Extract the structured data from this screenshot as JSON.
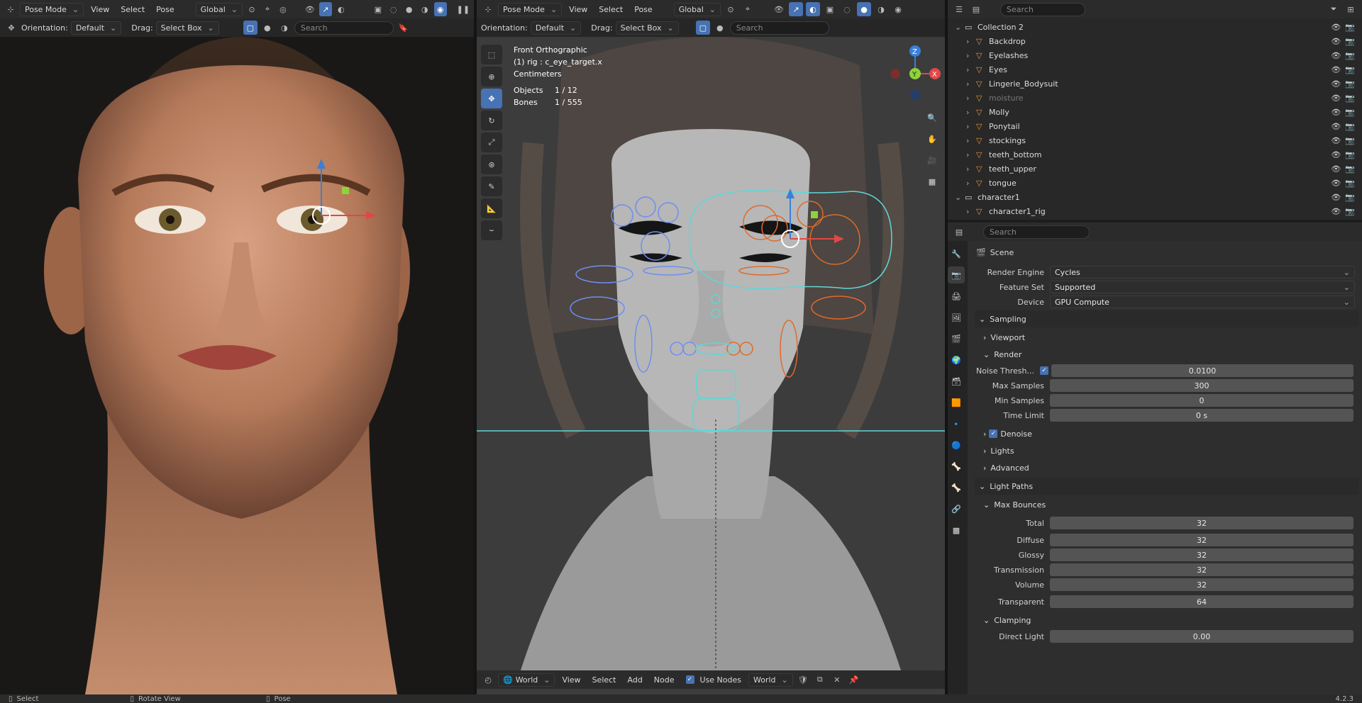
{
  "left_view": {
    "mode": "Pose Mode",
    "menus": [
      "View",
      "Select",
      "Pose"
    ],
    "transform_space": "Global",
    "orientation_label": "Orientation:",
    "orientation_value": "Default",
    "drag_label": "Drag:",
    "drag_value": "Select Box",
    "search_placeholder": "Search"
  },
  "right_view": {
    "mode": "Pose Mode",
    "menus": [
      "View",
      "Select",
      "Pose"
    ],
    "transform_space": "Global",
    "orientation_label": "Orientation:",
    "orientation_value": "Default",
    "drag_label": "Drag:",
    "drag_value": "Select Box",
    "search_placeholder": "Search",
    "overlay": {
      "view_name": "Front Orthographic",
      "selection": "(1) rig : c_eye_target.x",
      "units": "Centimeters",
      "objects_label": "Objects",
      "objects_value": "1 / 12",
      "bones_label": "Bones",
      "bones_value": "1 / 555"
    },
    "bottom_bar": {
      "world_dropdown": "World",
      "menus": [
        "View",
        "Select",
        "Add",
        "Node"
      ],
      "use_nodes": "Use Nodes",
      "world_name": "World"
    }
  },
  "outliner": {
    "search_placeholder": "Search",
    "rows": [
      {
        "label": "Collection 2",
        "indent": 0
      },
      {
        "label": "Backdrop",
        "indent": 1
      },
      {
        "label": "Eyelashes",
        "indent": 1
      },
      {
        "label": "Eyes",
        "indent": 1
      },
      {
        "label": "Lingerie_Bodysuit",
        "indent": 1
      },
      {
        "label": "moisture",
        "indent": 1
      },
      {
        "label": "Molly",
        "indent": 1
      },
      {
        "label": "Ponytail",
        "indent": 1
      },
      {
        "label": "stockings",
        "indent": 1
      },
      {
        "label": "teeth_bottom",
        "indent": 1
      },
      {
        "label": "teeth_upper",
        "indent": 1
      },
      {
        "label": "tongue",
        "indent": 1
      },
      {
        "label": "character1",
        "indent": 0
      },
      {
        "label": "character1_rig",
        "indent": 1
      }
    ]
  },
  "properties": {
    "search_placeholder": "Search",
    "scene_label": "Scene",
    "render_engine_label": "Render Engine",
    "render_engine_value": "Cycles",
    "feature_set_label": "Feature Set",
    "feature_set_value": "Supported",
    "device_label": "Device",
    "device_value": "GPU Compute",
    "sampling": "Sampling",
    "viewport": "Viewport",
    "render": "Render",
    "noise_label": "Noise Thresh...",
    "noise_value": "0.0100",
    "max_samples_label": "Max Samples",
    "max_samples_value": "300",
    "min_samples_label": "Min Samples",
    "min_samples_value": "0",
    "time_limit_label": "Time Limit",
    "time_limit_value": "0 s",
    "denoise": "Denoise",
    "lights": "Lights",
    "advanced": "Advanced",
    "light_paths": "Light Paths",
    "max_bounces": "Max Bounces",
    "total_label": "Total",
    "total_value": "32",
    "diffuse_label": "Diffuse",
    "diffuse_value": "32",
    "glossy_label": "Glossy",
    "glossy_value": "32",
    "transmission_label": "Transmission",
    "transmission_value": "32",
    "volume_label": "Volume",
    "volume_value": "32",
    "transparent_label": "Transparent",
    "transparent_value": "64",
    "clamping": "Clamping",
    "direct_light_label": "Direct Light",
    "direct_light_value": "0.00"
  },
  "statusbar": {
    "select": "Select",
    "rotate": "Rotate View",
    "pose": "Pose",
    "version": "4.2.3"
  },
  "colors": {
    "accent": "#4772b3",
    "axis_x": "#e04848",
    "axis_y": "#8ed339",
    "axis_z": "#3b7fd6",
    "rig_blue": "#6f8df0",
    "rig_orange": "#e06a2a",
    "rig_cyan": "#5fd7d7"
  }
}
